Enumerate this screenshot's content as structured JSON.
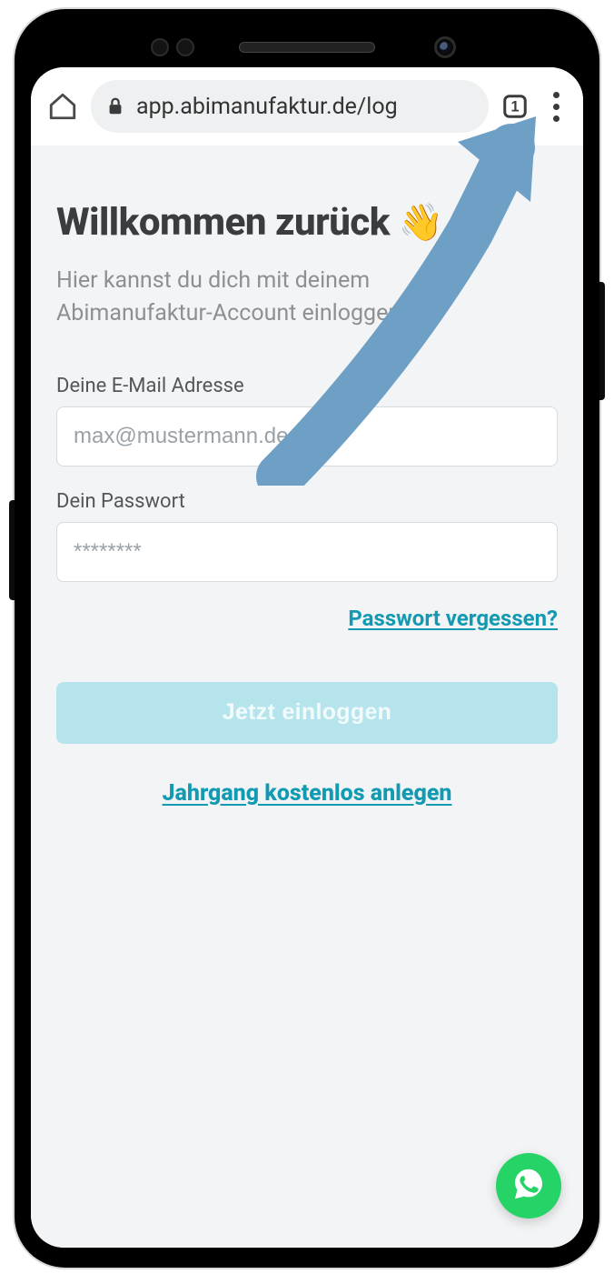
{
  "browser": {
    "url": "app.abimanufaktur.de/log",
    "tab_count": "1",
    "icons": {
      "home": "home-icon",
      "lock": "lock-icon",
      "tabs": "tabs-icon",
      "menu": "kebab-menu-icon"
    }
  },
  "overlay": {
    "arrow_points_to": "kebab-menu-icon",
    "arrow_color": "#6E9FC4"
  },
  "page": {
    "title": "Willkommen zurück",
    "title_emoji": "👋",
    "subtitle": "Hier kannst du dich mit deinem Abimanufaktur-Account einloggen.",
    "email": {
      "label": "Deine E-Mail Adresse",
      "placeholder": "max@mustermann.de",
      "value": ""
    },
    "password": {
      "label": "Dein Passwort",
      "placeholder": "********",
      "value": ""
    },
    "forgot_label": "Passwort vergessen?",
    "login_button": "Jetzt einloggen",
    "signup_link": "Jahrgang kostenlos anlegen",
    "fab_icon": "whatsapp-icon",
    "colors": {
      "link": "#129ab3",
      "login_btn_bg": "#b6e4ec",
      "page_bg": "#f3f4f5",
      "wa_green": "#25D366"
    }
  }
}
